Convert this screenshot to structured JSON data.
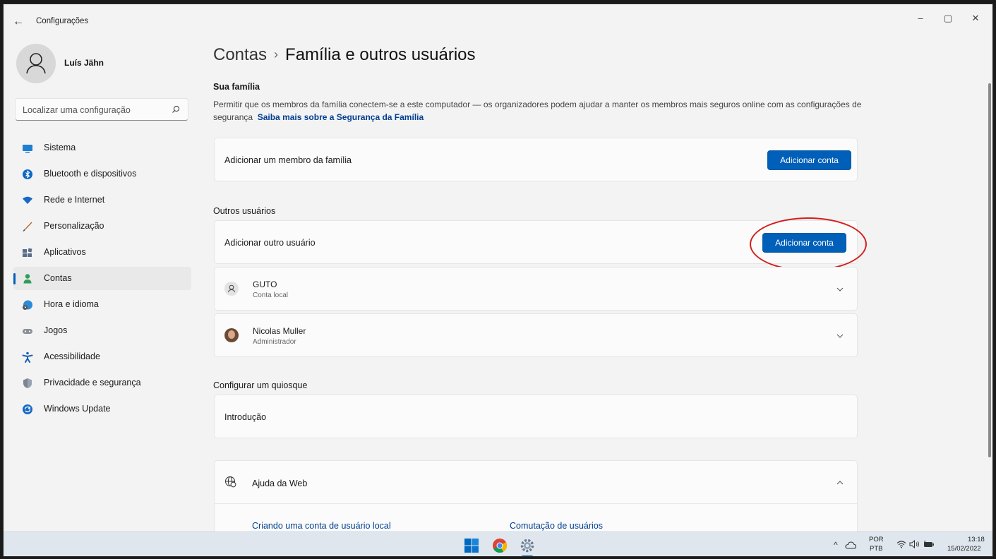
{
  "window": {
    "title": "Configurações",
    "back": "←",
    "minimize": "–",
    "restore": "▢",
    "close": "✕"
  },
  "user": {
    "name": "Luís Jähn"
  },
  "search": {
    "placeholder": "Localizar uma configuração"
  },
  "nav": [
    {
      "label": "Sistema",
      "icon": "monitor-icon",
      "color": "#1e7fd0"
    },
    {
      "label": "Bluetooth e dispositivos",
      "icon": "bluetooth-icon",
      "color": "#0b68c5"
    },
    {
      "label": "Rede e Internet",
      "icon": "wifi-icon",
      "color": "#1869c7"
    },
    {
      "label": "Personalização",
      "icon": "brush-icon",
      "color": "#b36b2d"
    },
    {
      "label": "Aplicativos",
      "icon": "apps-icon",
      "color": "#5b6d88"
    },
    {
      "label": "Contas",
      "icon": "person-icon",
      "color": "#2d9f58",
      "active": true
    },
    {
      "label": "Hora e idioma",
      "icon": "globe-clock-icon",
      "color": "#2c8bd8"
    },
    {
      "label": "Jogos",
      "icon": "gamepad-icon",
      "color": "#8b8f96"
    },
    {
      "label": "Acessibilidade",
      "icon": "accessibility-icon",
      "color": "#1a5fb4"
    },
    {
      "label": "Privacidade e segurança",
      "icon": "shield-icon",
      "color": "#7c8593"
    },
    {
      "label": "Windows Update",
      "icon": "update-icon",
      "color": "#1769c4"
    }
  ],
  "breadcrumb": {
    "parent": "Contas",
    "separator": "›",
    "current": "Família e outros usuários"
  },
  "family": {
    "heading": "Sua família",
    "description": "Permitir que os membros da família conectem-se a este computador — os organizadores podem ajudar a manter os membros mais seguros online com as configurações de segurança",
    "link": "Saiba mais sobre a Segurança da Família",
    "add_label": "Adicionar um membro da família",
    "add_button": "Adicionar conta"
  },
  "others": {
    "heading": "Outros usuários",
    "add_label": "Adicionar outro usuário",
    "add_button": "Adicionar conta",
    "accounts": [
      {
        "name": "GUTO",
        "type": "Conta local"
      },
      {
        "name": "Nicolas Muller",
        "type": "Administrador"
      }
    ]
  },
  "kiosk": {
    "heading": "Configurar um quiosque",
    "label": "Introdução"
  },
  "web_help": {
    "title": "Ajuda da Web",
    "links": [
      "Criando uma conta de usuário local",
      "Comutação de usuários"
    ]
  },
  "taskbar": {
    "lang_top": "POR",
    "lang_bottom": "PTB",
    "time": "13:18",
    "date": "15/02/2022",
    "accent": "#0067c0"
  }
}
